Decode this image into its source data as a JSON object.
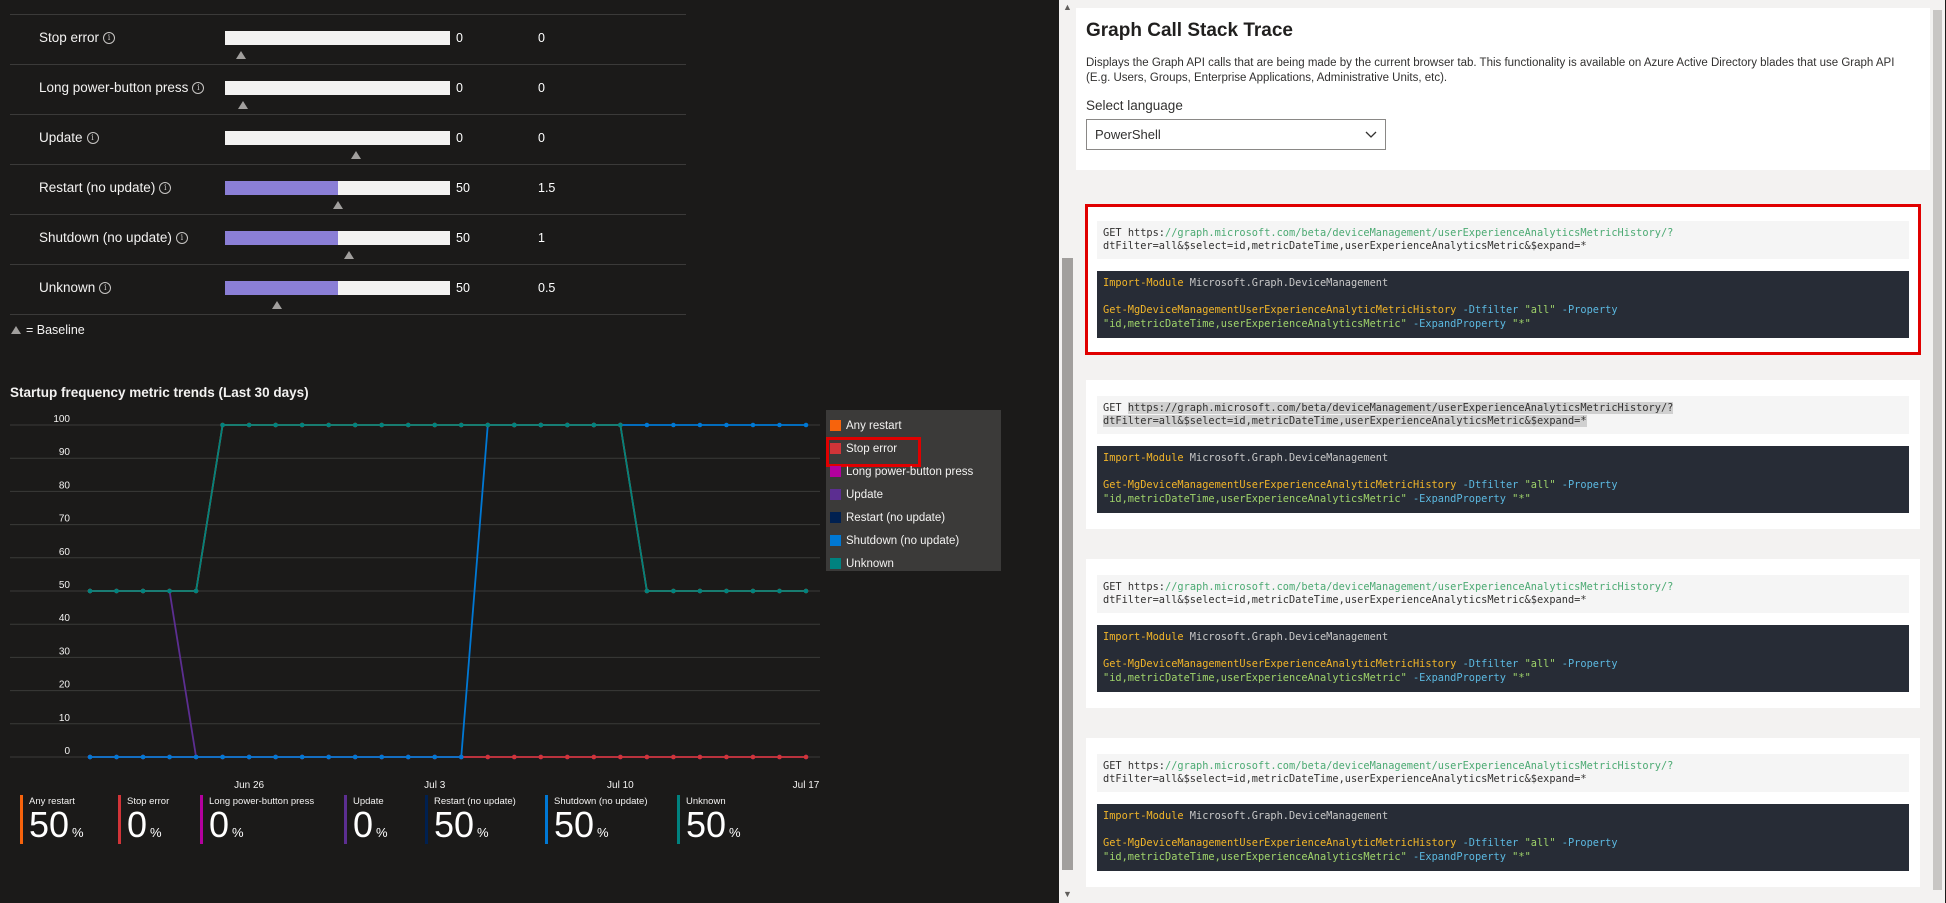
{
  "metrics": {
    "rows": [
      {
        "label": "Stop error",
        "fill": 0,
        "value": "0",
        "baseline_value": "0",
        "marker": 0.07
      },
      {
        "label": "Long power-button press",
        "fill": 0,
        "value": "0",
        "baseline_value": "0",
        "marker": 0.08
      },
      {
        "label": "Update",
        "fill": 0,
        "value": "0",
        "baseline_value": "0",
        "marker": 0.58
      },
      {
        "label": "Restart (no update)",
        "fill": 0.5,
        "value": "50",
        "baseline_value": "1.5",
        "marker": 0.5
      },
      {
        "label": "Shutdown (no update)",
        "fill": 0.5,
        "value": "50",
        "baseline_value": "1",
        "marker": 0.55
      },
      {
        "label": "Unknown",
        "fill": 0.5,
        "value": "50",
        "baseline_value": "0.5",
        "marker": 0.23
      }
    ],
    "baseline_note": "= Baseline"
  },
  "chart_data": {
    "type": "line",
    "title": "Startup frequency metric trends (Last 30 days)",
    "ylim": [
      0,
      100
    ],
    "y_ticks": [
      0,
      10,
      20,
      30,
      40,
      50,
      60,
      70,
      80,
      90,
      100
    ],
    "x_tick_labels": [
      {
        "label": "Jun 26",
        "index": 6
      },
      {
        "label": "Jul 3",
        "index": 13
      },
      {
        "label": "Jul 10",
        "index": 20
      },
      {
        "label": "Jul 17",
        "index": 27
      }
    ],
    "n_points": 28,
    "legend_placement": "right",
    "series": [
      {
        "name": "Any restart",
        "color": "#f7630c",
        "values": [
          50,
          50,
          50,
          50,
          50,
          100,
          100,
          100,
          100,
          100,
          100,
          100,
          100,
          100,
          100,
          100,
          100,
          100,
          100,
          100,
          100,
          50,
          50,
          50,
          50,
          50,
          50,
          50
        ]
      },
      {
        "name": "Stop error",
        "color": "#d13438",
        "values": [
          0,
          0,
          0,
          0,
          0,
          0,
          0,
          0,
          0,
          0,
          0,
          0,
          0,
          0,
          0,
          0,
          0,
          0,
          0,
          0,
          0,
          0,
          0,
          0,
          0,
          0,
          0,
          0
        ]
      },
      {
        "name": "Long power-button press",
        "color": "#b4009e",
        "values": [
          0,
          0,
          0,
          0,
          0,
          0,
          0,
          0,
          0,
          0,
          0,
          0,
          0,
          0,
          0,
          0,
          0,
          0,
          0,
          0,
          0,
          0,
          0,
          0,
          0,
          0,
          0,
          0
        ]
      },
      {
        "name": "Update",
        "color": "#5c2e91",
        "values": [
          50,
          50,
          50,
          50,
          0,
          0,
          0,
          0,
          0,
          0,
          0,
          0,
          0,
          0,
          0,
          0,
          0,
          0,
          0,
          0,
          0,
          0,
          0,
          0,
          0,
          0,
          0,
          0
        ]
      },
      {
        "name": "Restart (no update)",
        "color": "#002050",
        "values": [
          0,
          0,
          0,
          0,
          0,
          0,
          0,
          0,
          0,
          0,
          0,
          0,
          0,
          0,
          0,
          0,
          0,
          0,
          0,
          0,
          0,
          0,
          0,
          0,
          0,
          0,
          0,
          0
        ]
      },
      {
        "name": "Shutdown (no update)",
        "color": "#0078d4",
        "values": [
          0,
          0,
          0,
          0,
          0,
          0,
          0,
          0,
          0,
          0,
          0,
          0,
          0,
          0,
          0,
          100,
          100,
          100,
          100,
          100,
          100,
          100,
          100,
          100,
          100,
          100,
          100,
          100
        ]
      },
      {
        "name": "Unknown",
        "color": "#00827f",
        "values": [
          50,
          50,
          50,
          50,
          50,
          100,
          100,
          100,
          100,
          100,
          100,
          100,
          100,
          100,
          100,
          100,
          100,
          100,
          100,
          100,
          100,
          50,
          50,
          50,
          50,
          50,
          50,
          50
        ]
      }
    ]
  },
  "legend": [
    {
      "label": "Any restart",
      "color": "#f7630c"
    },
    {
      "label": "Stop error",
      "color": "#d13438"
    },
    {
      "label": "Long power-button press",
      "color": "#b4009e"
    },
    {
      "label": "Update",
      "color": "#5c2e91"
    },
    {
      "label": "Restart (no update)",
      "color": "#002050"
    },
    {
      "label": "Shutdown (no update)",
      "color": "#0078d4"
    },
    {
      "label": "Unknown",
      "color": "#00827f"
    }
  ],
  "kpis": [
    {
      "name": "Any restart",
      "value": "50",
      "unit": "%",
      "color": "#f7630c"
    },
    {
      "name": "Stop error",
      "value": "0",
      "unit": "%",
      "color": "#d13438"
    },
    {
      "name": "Long power-button press",
      "value": "0",
      "unit": "%",
      "color": "#b4009e"
    },
    {
      "name": "Update",
      "value": "0",
      "unit": "%",
      "color": "#5c2e91"
    },
    {
      "name": "Restart (no update)",
      "value": "50",
      "unit": "%",
      "color": "#002050"
    },
    {
      "name": "Shutdown (no update)",
      "value": "50",
      "unit": "%",
      "color": "#0078d4"
    },
    {
      "name": "Unknown",
      "value": "50",
      "unit": "%",
      "color": "#00827f"
    }
  ],
  "trace": {
    "title": "Graph Call Stack Trace",
    "description": "Displays the Graph API calls that are being made by the current browser tab. This functionality is available on Azure Active Directory blades that use Graph API (E.g. Users, Groups, Enterprise Applications, Administrative Units, etc).",
    "select_label": "Select language",
    "language": "PowerShell",
    "calls": [
      {
        "method": "GET",
        "url_host": "https:",
        "url_rest": "//graph.microsoft.com/beta/deviceManagement/userExperienceAnalyticsMetricHistory/?",
        "url_query": "dtFilter=all&$select=id,metricDateTime,userExperienceAnalyticsMetric&$expand=*",
        "import_cmd": "Import-Module",
        "import_mod": "Microsoft.Graph.DeviceManagement",
        "cmdlet": "Get-MgDeviceManagementUserExperienceAnalyticMetricHistory",
        "p1": "-Dtfilter",
        "p1v": "\"all\"",
        "p2": "-Property",
        "p2v": "\"id,metricDateTime,userExperienceAnalyticsMetric\"",
        "p3": "-ExpandProperty",
        "p3v": "\"*\""
      },
      {
        "method": "GET",
        "full_url": "https://graph.microsoft.com/beta/deviceManagement/userExperienceAnalyticsMetricHistory/?",
        "url_query": "dtFilter=all&$select=id,metricDateTime,userExperienceAnalyticsMetric&$expand=*",
        "import_cmd": "Import-Module",
        "import_mod": "Microsoft.Graph.DeviceManagement",
        "cmdlet": "Get-MgDeviceManagementUserExperienceAnalyticMetricHistory",
        "p1": "-Dtfilter",
        "p1v": "\"all\"",
        "p2": "-Property",
        "p2v": "\"id,metricDateTime,userExperienceAnalyticsMetric\"",
        "p3": "-ExpandProperty",
        "p3v": "\"*\""
      },
      {
        "method": "GET",
        "url_host": "https:",
        "url_rest": "//graph.microsoft.com/beta/deviceManagement/userExperienceAnalyticsMetricHistory/?",
        "url_query": "dtFilter=all&$select=id,metricDateTime,userExperienceAnalyticsMetric&$expand=*",
        "import_cmd": "Import-Module",
        "import_mod": "Microsoft.Graph.DeviceManagement",
        "cmdlet": "Get-MgDeviceManagementUserExperienceAnalyticMetricHistory",
        "p1": "-Dtfilter",
        "p1v": "\"all\"",
        "p2": "-Property",
        "p2v": "\"id,metricDateTime,userExperienceAnalyticsMetric\"",
        "p3": "-ExpandProperty",
        "p3v": "\"*\""
      },
      {
        "method": "GET",
        "url_host": "https:",
        "url_rest": "//graph.microsoft.com/beta/deviceManagement/userExperienceAnalyticsMetricHistory/?",
        "url_query": "dtFilter=all&$select=id,metricDateTime,userExperienceAnalyticsMetric&$expand=*",
        "import_cmd": "Import-Module",
        "import_mod": "Microsoft.Graph.DeviceManagement",
        "cmdlet": "Get-MgDeviceManagementUserExperienceAnalyticMetricHistory",
        "p1": "-Dtfilter",
        "p1v": "\"all\"",
        "p2": "-Property",
        "p2v": "\"id,metricDateTime,userExperienceAnalyticsMetric\"",
        "p3": "-ExpandProperty",
        "p3v": "\"*\""
      }
    ]
  }
}
